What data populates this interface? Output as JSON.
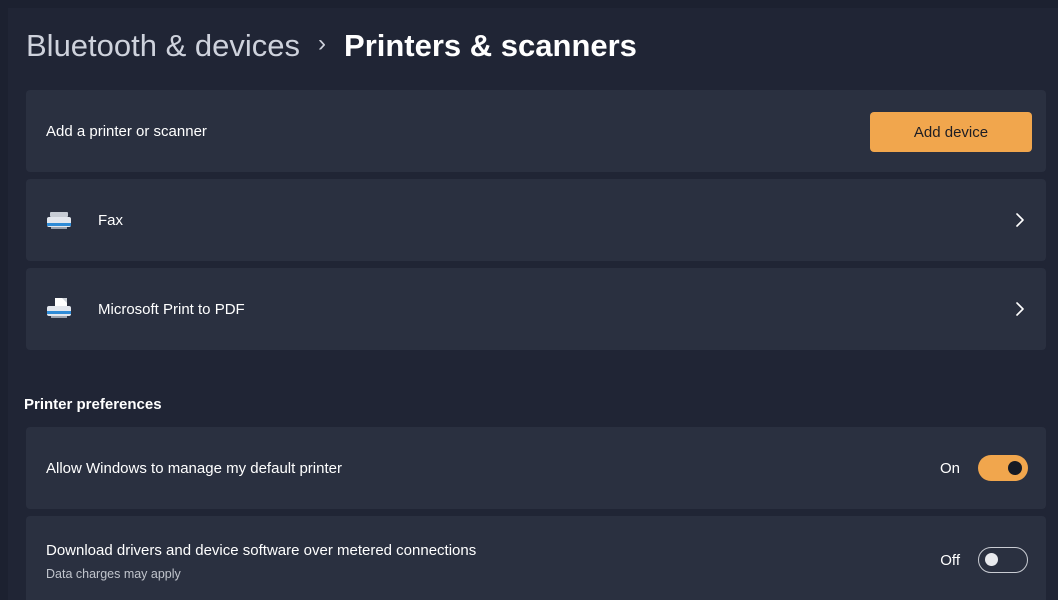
{
  "breadcrumb": {
    "parent": "Bluetooth & devices",
    "separator": "›",
    "current": "Printers & scanners"
  },
  "add_printer": {
    "label": "Add a printer or scanner",
    "button_label": "Add device"
  },
  "devices": [
    {
      "name": "Fax",
      "icon": "fax-icon"
    },
    {
      "name": "Microsoft Print to PDF",
      "icon": "printer-icon"
    }
  ],
  "preferences": {
    "title": "Printer preferences",
    "items": [
      {
        "label": "Allow Windows to manage my default printer",
        "state": "On",
        "enabled": true
      },
      {
        "label": "Download drivers and device software over metered connections",
        "sublabel": "Data charges may apply",
        "state": "Off",
        "enabled": false
      }
    ]
  },
  "colors": {
    "accent": "#f1a64d",
    "card": "#2a3040",
    "background": "#202535"
  }
}
